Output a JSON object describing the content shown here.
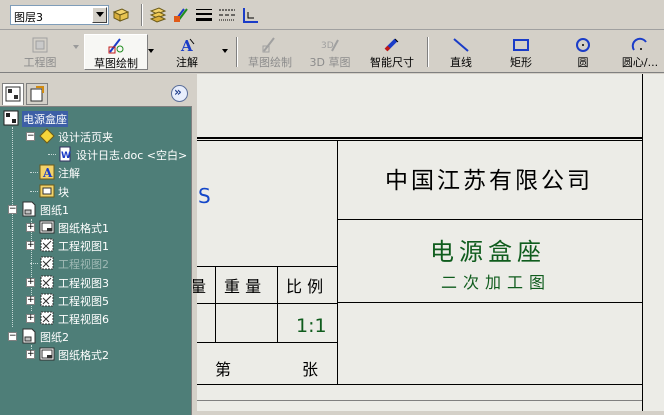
{
  "toolbar": {
    "layer": "图层3",
    "icons": [
      "layer-properties-icon",
      "layer-stack-icon",
      "line-color-icon",
      "line-thickness-icon",
      "line-style-icon",
      "edge-display-icon"
    ]
  },
  "command_manager": {
    "items": [
      {
        "label": "工程图",
        "icon": "drawing-icon",
        "enabled": false
      },
      {
        "label": "草图绘制",
        "icon": "sketch-icon",
        "enabled": true,
        "active": true
      },
      {
        "label": "注解",
        "icon": "annotation-icon",
        "enabled": true
      },
      {
        "label": "草图绘制",
        "icon": "sketch-icon",
        "enabled": false
      },
      {
        "label": "3D 草图",
        "icon": "3d-sketch-icon",
        "enabled": false
      },
      {
        "label": "智能尺寸",
        "icon": "smart-dimension-icon",
        "enabled": true
      },
      {
        "label": "直线",
        "icon": "line-icon",
        "enabled": true
      },
      {
        "label": "矩形",
        "icon": "rectangle-icon",
        "enabled": true
      },
      {
        "label": "圆",
        "icon": "circle-icon",
        "enabled": true
      },
      {
        "label": "圆心/...",
        "icon": "centerpoint-arc-icon",
        "enabled": true
      }
    ]
  },
  "feature_manager": {
    "root": "电源盒座",
    "items": [
      {
        "label": "设计活页夹",
        "level": 1,
        "expand": "-",
        "icon": "design-binder-icon"
      },
      {
        "label": "设计日志.doc <空白>",
        "level": 2,
        "expand": "",
        "icon": "word-document-icon"
      },
      {
        "label": "注解",
        "level": 1,
        "expand": "",
        "icon": "annotation-icon"
      },
      {
        "label": "块",
        "level": 1,
        "expand": "",
        "icon": "block-icon"
      },
      {
        "label": "图纸1",
        "level": 0,
        "expand": "-",
        "icon": "sheet-icon"
      },
      {
        "label": "图纸格式1",
        "level": 1,
        "expand": "+",
        "icon": "sheet-format-icon"
      },
      {
        "label": "工程视图1",
        "level": 1,
        "expand": "+",
        "icon": "drawing-view-icon"
      },
      {
        "label": "工程视图2",
        "level": 1,
        "expand": "",
        "icon": "drawing-view-icon",
        "dim": true
      },
      {
        "label": "工程视图3",
        "level": 1,
        "expand": "+",
        "icon": "drawing-view-icon"
      },
      {
        "label": "工程视图5",
        "level": 1,
        "expand": "+",
        "icon": "drawing-view-icon"
      },
      {
        "label": "工程视图6",
        "level": 1,
        "expand": "+",
        "icon": "drawing-view-icon"
      },
      {
        "label": "图纸2",
        "level": 0,
        "expand": "-",
        "icon": "sheet-icon"
      },
      {
        "label": "图纸格式2",
        "level": 1,
        "expand": "+",
        "icon": "sheet-format-icon"
      }
    ]
  },
  "title_block": {
    "company": "中国江苏有限公司",
    "part_name": "电源盒座",
    "process": "二次加工图",
    "left_fragment": "S",
    "qty_fragment": "量",
    "weight_label": "重 量",
    "scale_label": "比 例",
    "scale_value": "1:1",
    "sheet_label": "第",
    "sheet_total_label": "张"
  },
  "colors": {
    "feature_manager_bg": "#4e7e78",
    "title_green": "#0f5c1d",
    "link_blue": "#1447c9"
  }
}
